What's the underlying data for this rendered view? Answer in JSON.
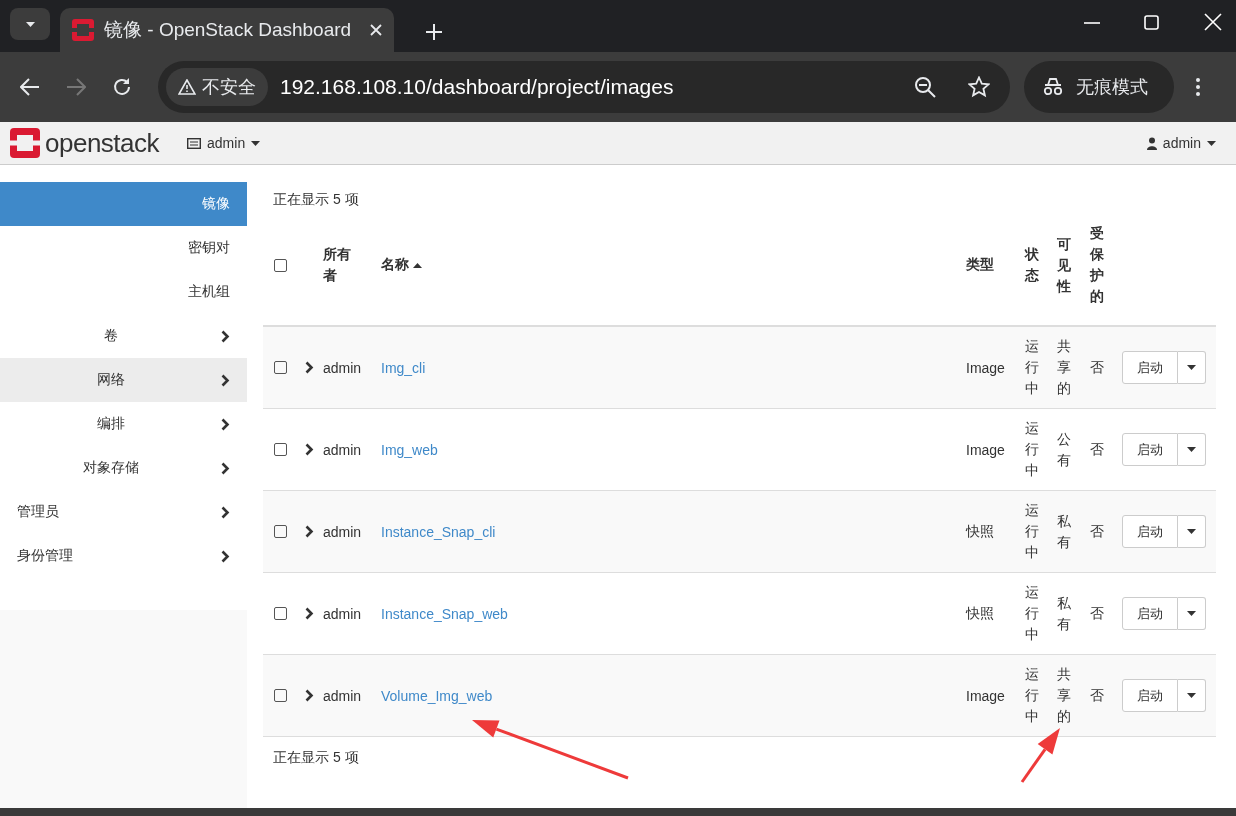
{
  "browser": {
    "tab_title": "镜像 - OpenStack Dashboard",
    "security": "不安全",
    "url": "192.168.108.10/dashboard/project/images",
    "incognito": "无痕模式"
  },
  "header": {
    "logo": "openstack",
    "project": "admin",
    "user": "admin"
  },
  "sidebar": {
    "items": [
      {
        "kind": "panel",
        "label": "镜像",
        "selected": true,
        "hovered": false
      },
      {
        "kind": "panel",
        "label": "密钥对",
        "selected": false,
        "hovered": false
      },
      {
        "kind": "panel",
        "label": "主机组",
        "selected": false,
        "hovered": false
      },
      {
        "kind": "subgroup",
        "label": "卷",
        "selected": false,
        "hovered": false
      },
      {
        "kind": "subgroup",
        "label": "网络",
        "selected": false,
        "hovered": true
      },
      {
        "kind": "subgroup",
        "label": "编排",
        "selected": false,
        "hovered": false
      },
      {
        "kind": "subgroup",
        "label": "对象存储",
        "selected": false,
        "hovered": false
      },
      {
        "kind": "group",
        "label": "管理员",
        "selected": false,
        "hovered": false
      },
      {
        "kind": "group",
        "label": "身份管理",
        "selected": false,
        "hovered": false
      }
    ]
  },
  "table": {
    "count_top": "正在显示 5 项",
    "count_bottom": "正在显示 5 项",
    "select_all_checked": false,
    "columns": [
      {
        "label": "所有者",
        "sorted": false
      },
      {
        "label": "名称",
        "sorted": true
      },
      {
        "label": "类型",
        "sorted": false
      },
      {
        "label": "状态",
        "sorted": false
      },
      {
        "label": "可见性",
        "sorted": false
      },
      {
        "label": "受保护的",
        "sorted": false
      }
    ],
    "rows": [
      {
        "owner": "admin",
        "name": "Img_cli",
        "type": "Image",
        "status": "运行中",
        "visibility": "共享的",
        "protected": "否",
        "action": "启动",
        "checked": false
      },
      {
        "owner": "admin",
        "name": "Img_web",
        "type": "Image",
        "status": "运行中",
        "visibility": "公有",
        "protected": "否",
        "action": "启动",
        "checked": false
      },
      {
        "owner": "admin",
        "name": "Instance_Snap_cli",
        "type": "快照",
        "status": "运行中",
        "visibility": "私有",
        "protected": "否",
        "action": "启动",
        "checked": false
      },
      {
        "owner": "admin",
        "name": "Instance_Snap_web",
        "type": "快照",
        "status": "运行中",
        "visibility": "私有",
        "protected": "否",
        "action": "启动",
        "checked": false
      },
      {
        "owner": "admin",
        "name": "Volume_Img_web",
        "type": "Image",
        "status": "运行中",
        "visibility": "共享的",
        "protected": "否",
        "action": "启动",
        "checked": false
      }
    ]
  }
}
